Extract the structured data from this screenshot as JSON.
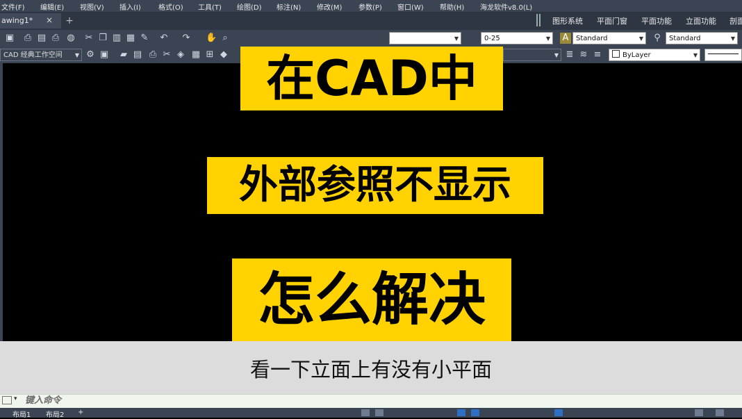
{
  "menu": [
    "文件(F)",
    "编辑(E)",
    "视图(V)",
    "插入(I)",
    "格式(O)",
    "工具(T)",
    "绘图(D)",
    "标注(N)",
    "修改(M)",
    "参数(P)",
    "窗口(W)",
    "帮助(H)",
    "海龙软件v8.0(L)"
  ],
  "tabs": {
    "doc": "awing1*",
    "close": "×",
    "add": "+"
  },
  "func_tabs": [
    "图形系统",
    "平面门窗",
    "平面功能",
    "立面功能",
    "剖面"
  ],
  "toolbar": {
    "dimstyle": "0-25",
    "textstyle": "Standard",
    "tablestyle": "Standard",
    "workspace": "CAD 经典工作空间",
    "layer_color": "ByLayer"
  },
  "overlay": {
    "line1": "在CAD中",
    "line2": "外部参照不显示",
    "line3": "怎么解决"
  },
  "subtitle": "看一下立面上有没有小平面",
  "command": {
    "prompt": "键入命令"
  },
  "status": {
    "layout1": "布局1",
    "layout2": "布局2",
    "add": "+"
  },
  "colors": {
    "highlight": "#ffd200",
    "ui_bg": "#3b4453",
    "canvas": "#000000"
  }
}
